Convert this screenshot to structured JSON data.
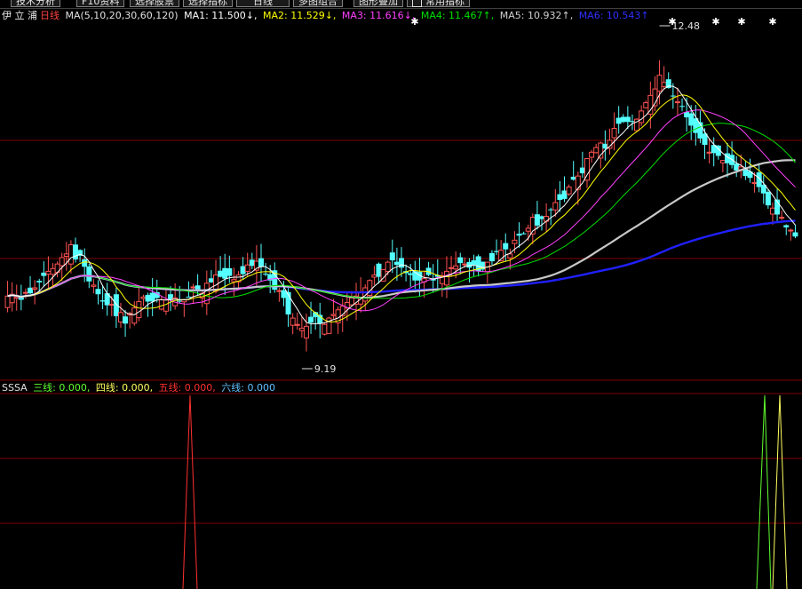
{
  "toolbar": {
    "buttons": [
      "技术分析",
      "F10资料",
      "选择股票",
      "选择指标",
      "日线",
      "多图组合",
      "图形叠加",
      "常用指标"
    ]
  },
  "main_legend": {
    "stock_name": "伊 立 浦",
    "period": "日线",
    "ma_params": "MA(5,10,20,30,60,120)",
    "ma1": "MA1: 11.500↓,",
    "ma2": "MA2: 11.529↓,",
    "ma3": "MA3: 11.616↓,",
    "ma4": "MA4: 11.467↑,",
    "ma5": "MA5: 10.932↑,",
    "ma6": "MA6: 10.543↑"
  },
  "annotations": {
    "high_label": "12.48",
    "low_label": "9.19"
  },
  "sub_legend": {
    "name": "SSSA",
    "line3": "三线: 0.000,",
    "line4": "四线: 0.000,",
    "line5": "五线: 0.000,",
    "line6": "六线: 0.000"
  },
  "colors": {
    "up": "#ff5252",
    "down": "#54ffff",
    "ma1": "#ffffff",
    "ma2": "#ffff00",
    "ma3": "#ff40ff",
    "ma4": "#00e000",
    "ma5": "#c8c8c8",
    "ma6": "#2020ff",
    "grid": "#800000",
    "sub_red": "#ff3030",
    "sub_green": "#60ff30",
    "sub_yellow": "#ffff60"
  },
  "chart_data": {
    "type": "candlestick",
    "ylim": [
      9.0,
      12.8
    ],
    "closes": [
      9.86,
      9.88,
      9.85,
      9.82,
      9.9,
      9.89,
      9.95,
      10.01,
      10.08,
      10.13,
      10.16,
      10.21,
      10.28,
      10.32,
      10.42,
      10.26,
      10.3,
      10.18,
      10.02,
      9.98,
      9.88,
      9.8,
      9.76,
      9.77,
      9.64,
      9.68,
      9.56,
      9.67,
      9.73,
      9.8,
      9.85,
      9.8,
      9.8,
      9.84,
      9.82,
      9.82,
      9.82,
      9.84,
      9.8,
      9.82,
      9.85,
      9.96,
      9.91,
      9.89,
      10.0,
      10.01,
      10.09,
      10.07,
      10.05,
      10.08,
      10.04,
      10.09,
      10.1,
      10.2,
      10.19,
      10.24,
      10.18,
      10.1,
      10.03,
      9.93,
      9.92,
      9.84,
      9.66,
      9.62,
      9.55,
      9.51,
      9.53,
      9.57,
      9.63,
      9.56,
      9.55,
      9.62,
      9.66,
      9.71,
      9.75,
      9.79,
      9.84,
      9.86,
      9.9,
      9.95,
      10.03,
      10.09,
      10.07,
      10.15,
      10.23,
      10.25,
      10.2,
      10.17,
      10.11,
      10.09,
      10.03,
      10.03,
      10.05,
      10.09,
      10.03,
      10.07,
      10.08,
      10.13,
      10.17,
      10.19,
      10.22,
      10.21,
      10.17,
      10.2,
      10.13,
      10.15,
      10.23,
      10.24,
      10.34,
      10.36,
      10.37,
      10.32,
      10.47,
      10.52,
      10.54,
      10.6,
      10.72,
      10.63,
      10.7,
      10.73,
      10.8,
      10.88,
      10.91,
      10.92,
      11.05,
      11.13,
      11.17,
      11.2,
      11.36,
      11.43,
      11.48,
      11.53,
      11.47,
      11.56,
      11.69,
      11.74,
      11.76,
      11.76,
      11.76,
      11.79,
      11.88,
      11.97,
      12.05,
      12.12,
      12.27,
      12.19,
      12.13,
      12.04,
      11.98,
      11.93,
      11.81,
      11.72,
      11.64,
      11.58,
      11.51,
      11.43,
      11.42,
      11.39,
      11.34,
      11.31,
      11.29,
      11.23,
      11.27,
      11.17,
      11.15,
      11.1,
      11.05,
      10.98,
      10.85,
      10.82,
      10.75,
      10.72,
      10.61,
      10.58,
      10.51
    ]
  }
}
